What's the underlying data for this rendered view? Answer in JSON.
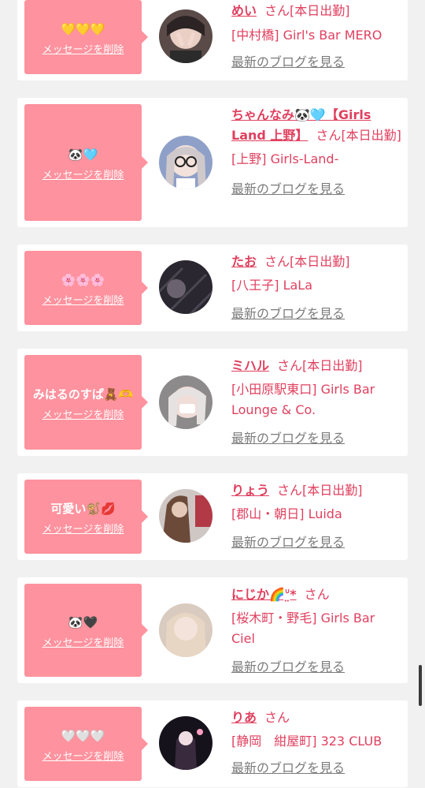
{
  "delete_label": "メッセージを削除",
  "blog_label": "最新のブログを見る",
  "san_label": "さん",
  "entries": [
    {
      "message": "💛💛💛",
      "name": "めい",
      "tag": "[本日出勤]",
      "shop": "[中村橋] Girl's Bar MERO",
      "avatar": "avatar-photo-1"
    },
    {
      "message": "🐼🩵",
      "name": "ちゃんなみ🐼🩵【Girls Land 上野】",
      "tag": "[本日出勤]",
      "shop": "[上野] Girls-Land-",
      "avatar": "avatar-photo-2"
    },
    {
      "message": "🌸🌸🌸",
      "name": "たお",
      "tag": "[本日出勤]",
      "shop": "[八王子] LaLa",
      "avatar": "avatar-photo-3"
    },
    {
      "message": "みはるのすぱ🧸🫶",
      "name": "ミハル",
      "tag": "[本日出勤]",
      "shop": "[小田原駅東口] Girls Bar Lounge & Co.",
      "avatar": "avatar-photo-4"
    },
    {
      "message": "可愛い🐒💋",
      "name": "りょう",
      "tag": "[本日出勤]",
      "shop": "[郡山・朝日] Luida",
      "avatar": "avatar-photo-5"
    },
    {
      "message": "🐼🖤",
      "name": "にじか🌈ᐡ̤*",
      "tag": "",
      "shop": "[桜木町・野毛] Girls Bar Ciel",
      "avatar": "avatar-photo-6"
    },
    {
      "message": "🤍🤍🤍",
      "name": "りあ",
      "tag": "",
      "shop": "[静岡　紺屋町] 323 CLUB",
      "avatar": "avatar-photo-7"
    }
  ]
}
